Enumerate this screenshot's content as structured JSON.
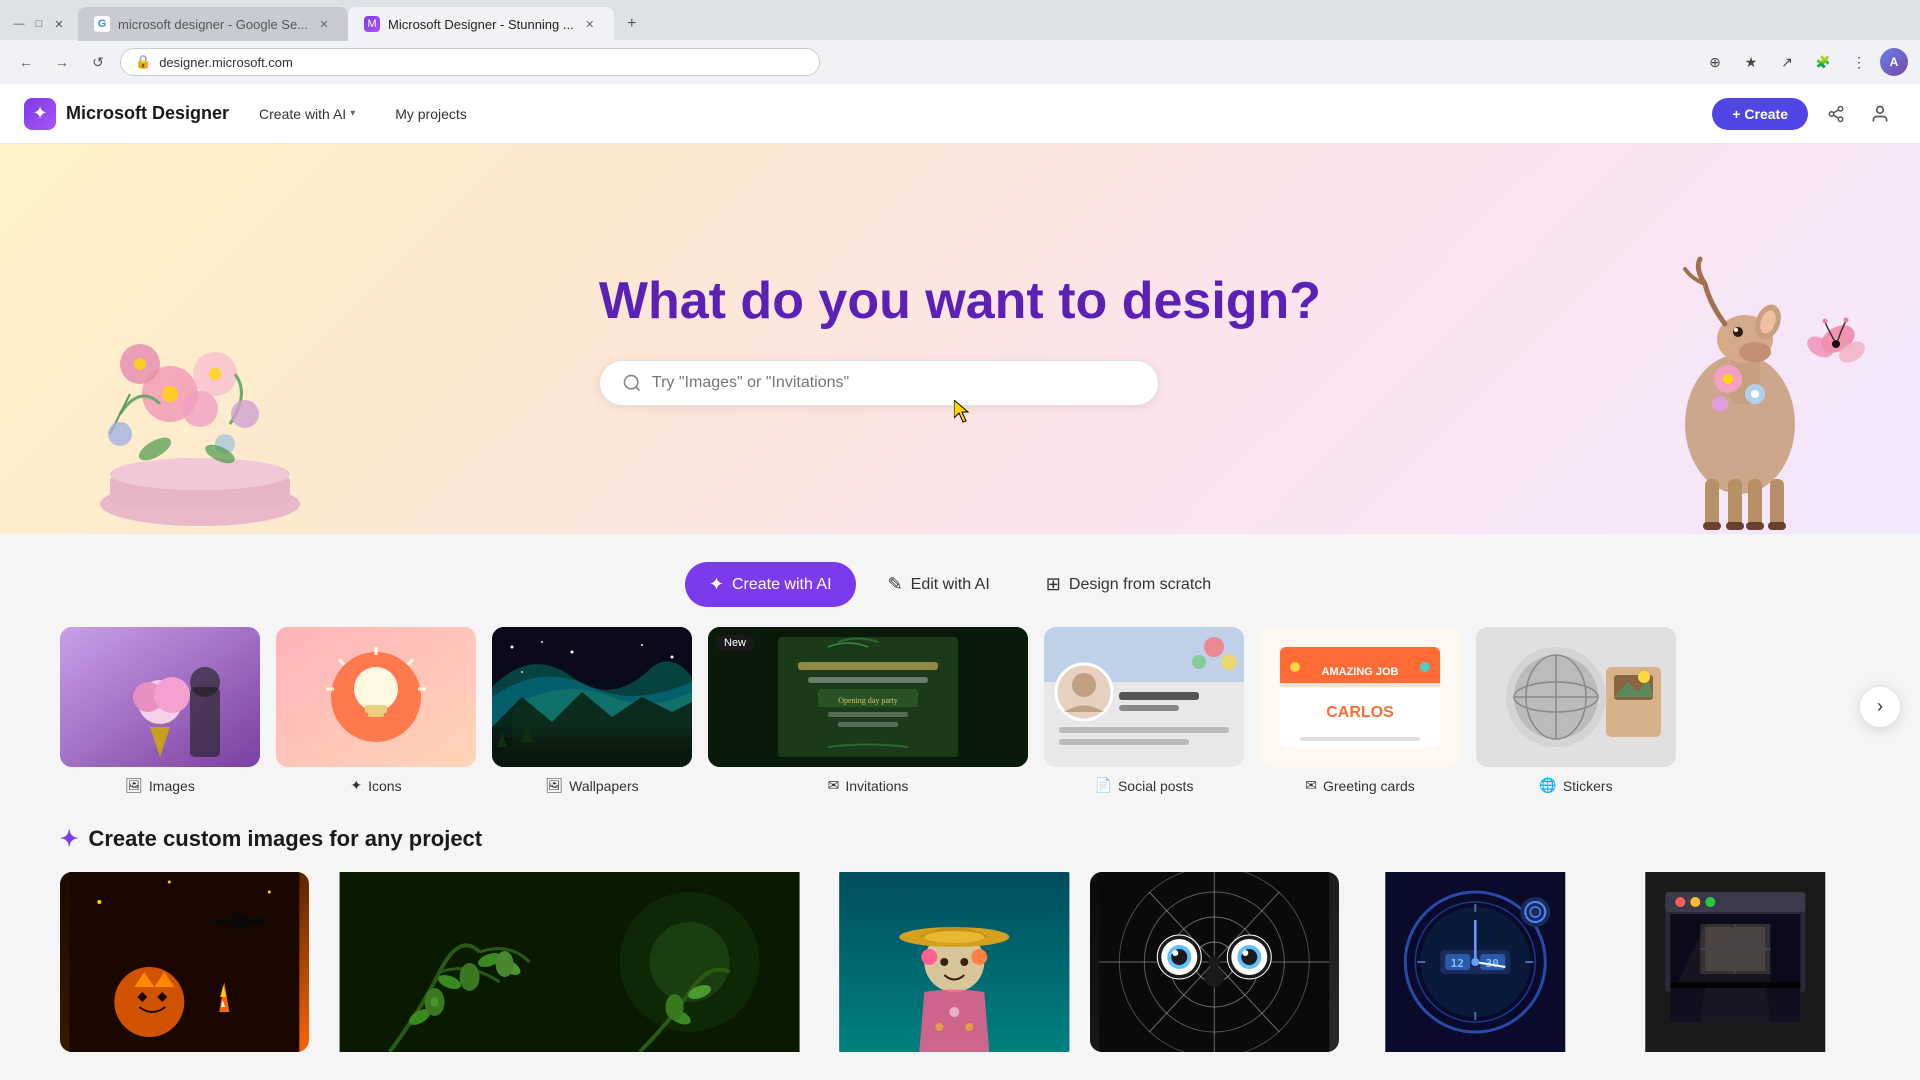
{
  "browser": {
    "tabs": [
      {
        "id": "tab1",
        "favicon": "G",
        "label": "microsoft designer - Google Se...",
        "active": false,
        "closeable": true
      },
      {
        "id": "tab2",
        "favicon": "M",
        "label": "Microsoft Designer - Stunning ...",
        "active": true,
        "closeable": true
      }
    ],
    "new_tab_icon": "+",
    "address": "designer.microsoft.com",
    "nav": {
      "back": "←",
      "forward": "→",
      "reload": "↺",
      "home": "⌂"
    },
    "toolbar_icons": [
      "⊕",
      "★",
      "↗",
      "☰"
    ],
    "window_controls": [
      "—",
      "□",
      "✕"
    ]
  },
  "app": {
    "logo_icon": "✦",
    "logo_text": "Microsoft Designer",
    "nav_items": [
      {
        "label": "Create with AI",
        "has_dropdown": true
      },
      {
        "label": "My projects",
        "has_dropdown": false
      }
    ],
    "create_button": "+ Create",
    "share_icon": "⤴",
    "user_icon": "👤"
  },
  "hero": {
    "title": "What do you want to design?",
    "search_placeholder": "Try \"Images\" or \"Invitations\""
  },
  "action_tabs": [
    {
      "id": "create-ai",
      "icon": "✦",
      "label": "Create with AI",
      "active": true
    },
    {
      "id": "edit-ai",
      "icon": "✎",
      "label": "Edit with AI",
      "active": false
    },
    {
      "id": "design-scratch",
      "icon": "⊞",
      "label": "Design from scratch",
      "active": false
    }
  ],
  "categories": [
    {
      "id": "images",
      "label": "Images",
      "icon": "🖼",
      "has_new": false,
      "color": "cat-images"
    },
    {
      "id": "icons",
      "label": "Icons",
      "icon": "✦",
      "has_new": false,
      "color": "cat-icons"
    },
    {
      "id": "wallpapers",
      "label": "Wallpapers",
      "icon": "🖼",
      "has_new": false,
      "color": "cat-wallpapers"
    },
    {
      "id": "invitations",
      "label": "Invitations",
      "icon": "✉",
      "has_new": true,
      "color": "cat-invitations"
    },
    {
      "id": "social-posts",
      "label": "Social posts",
      "icon": "📄",
      "has_new": false,
      "color": "cat-social"
    },
    {
      "id": "greeting-cards",
      "label": "Greeting cards",
      "icon": "✉",
      "has_new": false,
      "color": "cat-greeting"
    },
    {
      "id": "stickers",
      "label": "Stickers",
      "icon": "🌐",
      "has_new": false,
      "color": "cat-stickers"
    }
  ],
  "scroll_button": "›",
  "custom_section": {
    "title": "Create custom images for any project",
    "title_icon": "✦",
    "images": [
      {
        "id": "halloween",
        "color": "img-halloween"
      },
      {
        "id": "olives",
        "color": "img-olives"
      },
      {
        "id": "sombrero",
        "color": "img-sombrero"
      },
      {
        "id": "spiderweb",
        "color": "img-spiderweb"
      },
      {
        "id": "tech",
        "color": "img-tech"
      },
      {
        "id": "window",
        "color": "img-window"
      }
    ]
  },
  "new_badge": "New"
}
